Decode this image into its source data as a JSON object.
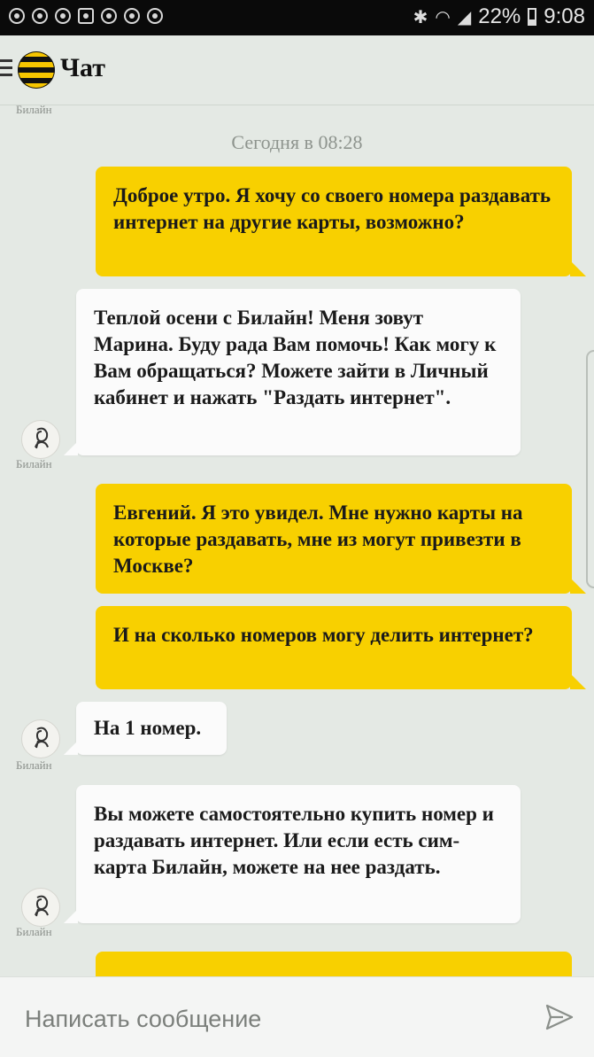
{
  "statusbar": {
    "bluetooth_icon": "bluetooth-icon",
    "wifi_icon": "wifi-icon",
    "signal_icon": "signal-icon",
    "battery": "22%",
    "time": "9:08"
  },
  "header": {
    "title": "Чат",
    "subtitle": "Билайн",
    "menu_icon": "menu-icon",
    "logo": "beeline-logo"
  },
  "chat": {
    "date_separator": "Сегодня в 08:28",
    "messages": [
      {
        "direction": "out",
        "text": "Доброе утро. Я хочу со своего номера раздавать интернет на другие карты, возможно?"
      },
      {
        "direction": "in",
        "sender": "Билайн",
        "text": "Теплой осени с Билайн! Меня зовут Марина. Буду рада Вам помочь! Как могу к Вам обращаться? Можете зайти в Личный кабинет и нажать \"Раздать интернет\"."
      },
      {
        "direction": "out",
        "text": "Евгений. Я это увидел. Мне нужно карты на которые раздавать, мне из могут привезти в Москве?"
      },
      {
        "direction": "out",
        "text": "И на сколько номеров могу делить интернет?"
      },
      {
        "direction": "in",
        "sender": "Билайн",
        "text": "На 1 номер."
      },
      {
        "direction": "in",
        "sender": "Билайн",
        "text": "Вы можете самостоятельно купить номер и раздавать интернет. Или если есть сим-карта Билайн, можете на нее раздать."
      }
    ]
  },
  "composer": {
    "placeholder": "Написать сообщение",
    "send_icon": "send-icon"
  },
  "colors": {
    "accent": "#f8d000",
    "background": "#e4e9e4",
    "incoming_bubble": "#fbfbfb"
  }
}
